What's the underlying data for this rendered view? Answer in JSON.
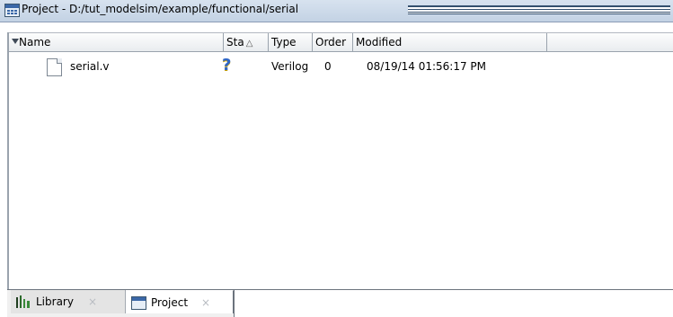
{
  "window": {
    "title": "Project - D:/tut_modelsim/example/functional/serial"
  },
  "columns": {
    "name": "Name",
    "status": "Sta",
    "status_sort": "△",
    "type": "Type",
    "order": "Order",
    "modified": "Modified"
  },
  "files": [
    {
      "name": "serial.v",
      "status": "?",
      "type": "Verilog",
      "order": "0",
      "modified": "08/19/14 01:56:17 PM"
    }
  ],
  "tabs": [
    {
      "label": "Library",
      "close": "×"
    },
    {
      "label": "Project",
      "close": "×"
    }
  ],
  "colors": {
    "status_icon": "#2f66c6",
    "title_bar": "#c3d2e4"
  }
}
